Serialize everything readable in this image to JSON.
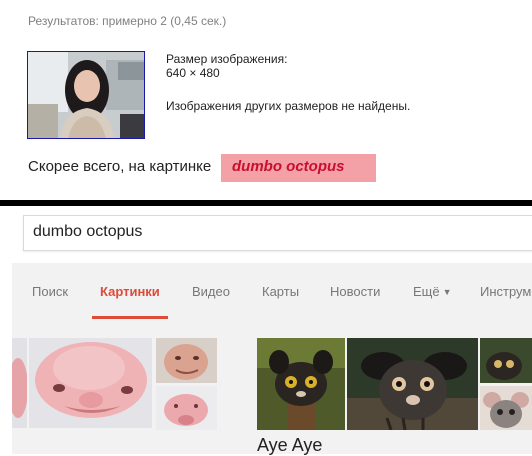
{
  "results_stats": "Результатов: примерно 2 (0,45 сек.)",
  "image_info": {
    "size_label": "Размер изображения:",
    "size_value": "640 × 480",
    "no_other_sizes": "Изображения других размеров не найдены."
  },
  "best_guess": {
    "prefix": "Скорее всего, на картинке",
    "link": "dumbo octopus"
  },
  "search": {
    "query": "dumbo octopus"
  },
  "tabs": [
    {
      "label": "Поиск"
    },
    {
      "label": "Картинки",
      "active": true
    },
    {
      "label": "Видео"
    },
    {
      "label": "Карты"
    },
    {
      "label": "Новости"
    },
    {
      "label": "Ещё"
    },
    {
      "label": "Инструм"
    }
  ],
  "results": {
    "aye_aye_caption": "Aye Aye"
  },
  "colors": {
    "accent_red": "#dd4b39",
    "highlight_pink": "#f3a0a7",
    "link_red": "#c8102e",
    "nav_bg": "#f2f2f2"
  },
  "icons": {
    "more_caret": "caret-down-icon"
  }
}
